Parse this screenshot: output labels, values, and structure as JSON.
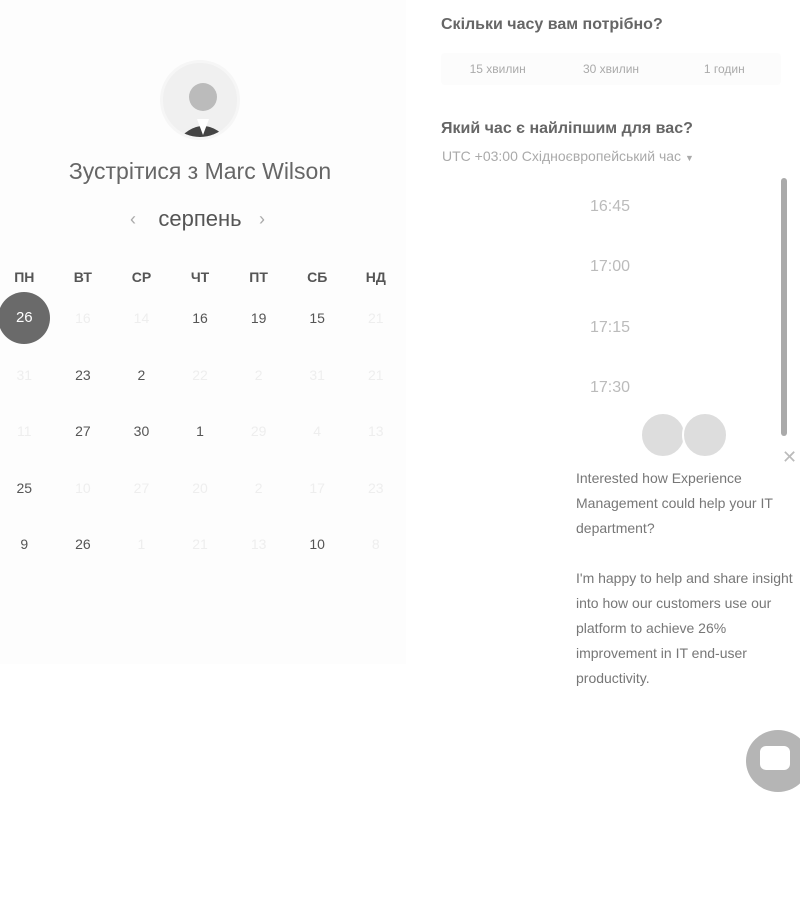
{
  "host": {
    "title": "Зустрітися з Marc Wilson",
    "month": "серпень"
  },
  "calendar": {
    "weekdays": [
      "ПН",
      "ВТ",
      "СР",
      "ЧТ",
      "ПТ",
      "СБ",
      "НД"
    ],
    "selected": "26",
    "rows": [
      [
        {
          "d": "26",
          "s": "sel"
        },
        {
          "d": "16",
          "s": "off"
        },
        {
          "d": "14",
          "s": "off"
        },
        {
          "d": "16",
          "s": ""
        },
        {
          "d": "19",
          "s": ""
        },
        {
          "d": "15",
          "s": ""
        },
        {
          "d": "21",
          "s": "off"
        }
      ],
      [
        {
          "d": "31",
          "s": "off"
        },
        {
          "d": "23",
          "s": ""
        },
        {
          "d": "2",
          "s": ""
        },
        {
          "d": "22",
          "s": "off"
        },
        {
          "d": "2",
          "s": "off"
        },
        {
          "d": "31",
          "s": "off"
        },
        {
          "d": "21",
          "s": "off"
        }
      ],
      [
        {
          "d": "11",
          "s": "off"
        },
        {
          "d": "27",
          "s": ""
        },
        {
          "d": "30",
          "s": ""
        },
        {
          "d": "1",
          "s": ""
        },
        {
          "d": "29",
          "s": "off"
        },
        {
          "d": "4",
          "s": "off"
        },
        {
          "d": "13",
          "s": "off"
        }
      ],
      [
        {
          "d": "25",
          "s": ""
        },
        {
          "d": "10",
          "s": "off"
        },
        {
          "d": "27",
          "s": "off"
        },
        {
          "d": "20",
          "s": "off"
        },
        {
          "d": "2",
          "s": "off"
        },
        {
          "d": "17",
          "s": "off"
        },
        {
          "d": "23",
          "s": "off"
        }
      ],
      [
        {
          "d": "9",
          "s": ""
        },
        {
          "d": "26",
          "s": ""
        },
        {
          "d": "1",
          "s": "off"
        },
        {
          "d": "21",
          "s": "off"
        },
        {
          "d": "13",
          "s": "off"
        },
        {
          "d": "10",
          "s": ""
        },
        {
          "d": "8",
          "s": "off"
        }
      ]
    ]
  },
  "duration": {
    "question": "Скільки часу вам потрібно?",
    "options": [
      "15 хвилин",
      "30 хвилин",
      "1 годин"
    ]
  },
  "time": {
    "question": "Який час є найліпшим для вас?",
    "timezone": "UTC +03:00 Східноєвропейський час",
    "slots": [
      "16:45",
      "17:00",
      "17:15",
      "17:30"
    ]
  },
  "chat": {
    "message1": "Interested how Experience Management could help your IT department?",
    "message2": "I'm happy to help and share insight into how our customers use our platform to achieve 26% improvement in IT end-user productivity."
  },
  "colors": {
    "selected": "#6a6a6a",
    "bubble": "#b5b5b5"
  }
}
